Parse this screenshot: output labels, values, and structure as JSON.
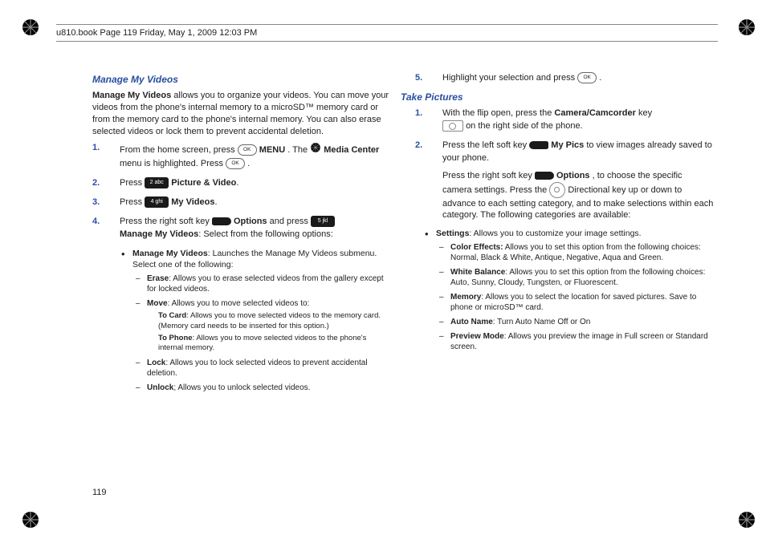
{
  "header": {
    "stamp": "u810.book  Page 119  Friday, May 1, 2009  12:03 PM"
  },
  "pageNumber": "119",
  "left": {
    "section": "Manage My Videos",
    "intro": "Manage My Videos allows you to organize your videos. You can move your videos from the phone's internal memory to a microSD™ memory card or from the memory card to the phone's internal memory. You can also erase selected videos or lock them to prevent accidental deletion.",
    "s1": {
      "n": "1.",
      "a": "From the home screen, press ",
      "menu": "MENU",
      "b": ". The ",
      "media": "Media Center",
      "c": " menu is highlighted. Press ",
      "d": " ."
    },
    "s2": {
      "n": "2.",
      "a": "Press ",
      "pv": "Picture & Video",
      "d": "."
    },
    "s3": {
      "n": "3.",
      "a": "Press ",
      "mv": "My Videos",
      "d": "."
    },
    "s4": {
      "n": "4.",
      "a": "Press the right soft key ",
      "opt": "Options",
      "b": " and press ",
      "mmv": "Manage My Videos",
      "c": ": Select from the following options:"
    },
    "b1": {
      "t": "Manage My Videos",
      "d": ": Launches the Manage My Videos submenu. Select one of the following:"
    },
    "erase": {
      "t": "Erase",
      "d": ": Allows you to erase selected videos from the gallery except for locked videos."
    },
    "move": {
      "t": "Move",
      "d": ": Allows you to move selected videos to:"
    },
    "tocard": {
      "t": "To Card",
      "d": ": Allows you to move selected videos to the memory card. (Memory card needs to be inserted for this option.)"
    },
    "tophone": {
      "t": "To Phone",
      "d": ": Allows you to move selected videos to the phone's internal memory."
    },
    "lock": {
      "t": "Lock",
      "d": ": Allows you to lock selected videos to prevent accidental deletion."
    },
    "unlock": {
      "t": "Unlock",
      "d": "; Allows you to unlock selected videos."
    }
  },
  "right": {
    "s5": {
      "n": "5.",
      "a": "Highlight your selection and press ",
      "d": " ."
    },
    "section": "Take Pictures",
    "s1": {
      "n": "1.",
      "a": "With the flip open, press the ",
      "cc": "Camera/Camcorder",
      "b": " key ",
      "c": " on the right side of the phone."
    },
    "s2": {
      "n": "2.",
      "a": "Press the left soft key ",
      "mp": "My Pics",
      "b": " to view images already saved to your phone.",
      "c": "Press the right soft key ",
      "opt": "Options",
      "d": ", to choose the specific camera settings. Press the ",
      "e": " Directional key up or down to advance to each setting category, and to make selections within each category. The following categories are available:"
    },
    "settings": {
      "t": "Settings",
      "d": ": Allows you to customize your image settings."
    },
    "ce": {
      "t": "Color Effects:",
      "d": " Allows you to set this option from the following choices: Normal, Black & White, Antique, Negative, Aqua and Green."
    },
    "wb": {
      "t": "White Balance",
      "d": ": Allows you to set this option from the following choices: Auto, Sunny, Cloudy, Tungsten, or Fluorescent."
    },
    "mem": {
      "t": "Memory",
      "d": ": Allows you to select the location for saved pictures. Save to phone or microSD™ card."
    },
    "an": {
      "t": "Auto Name",
      "d": ": Turn Auto Name Off or On"
    },
    "pm": {
      "t": "Preview Mode",
      "d": ": Allows you preview the image in Full screen or Standard screen."
    }
  }
}
